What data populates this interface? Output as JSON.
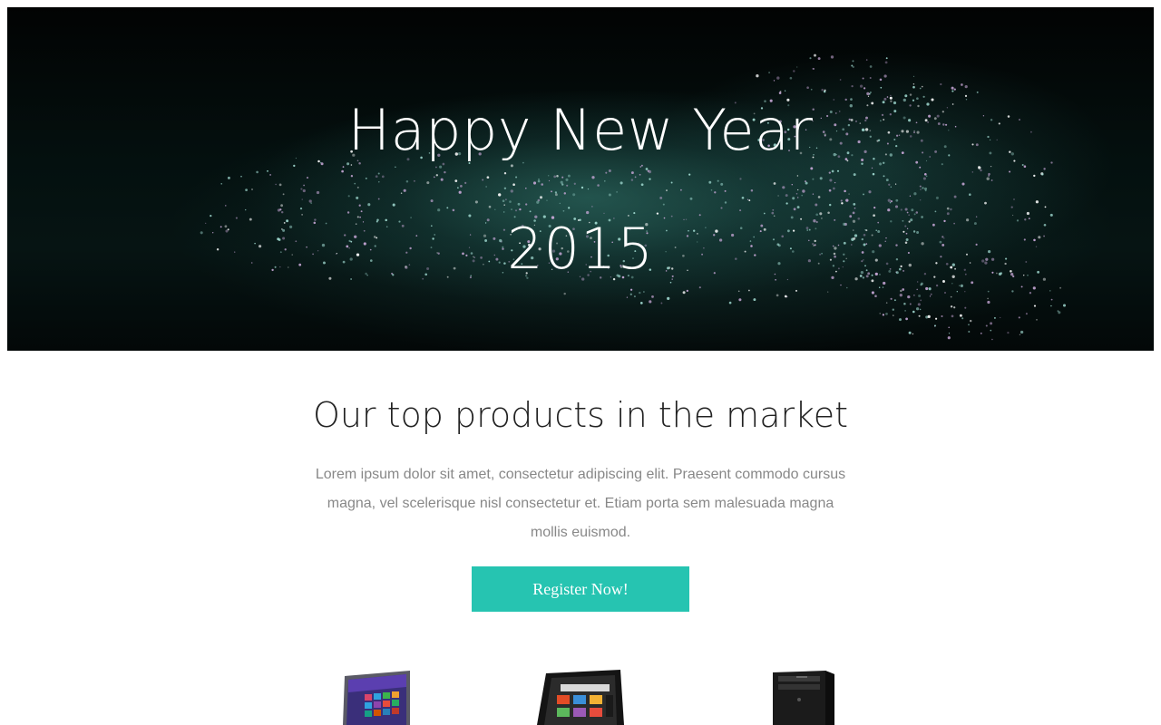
{
  "hero": {
    "title": "Happy New Year",
    "year": "2015"
  },
  "section": {
    "heading": "Our top products in the market",
    "text": "Lorem ipsum dolor sit amet, consectetur adipiscing elit. Praesent commodo cursus magna, vel scelerisque nisl consectetur et. Etiam porta sem malesuada magna mollis euismod.",
    "cta_label": "Register Now!"
  },
  "products": [
    {
      "icon": "laptop-icon"
    },
    {
      "icon": "tablet-icon"
    },
    {
      "icon": "desktop-tower-icon"
    }
  ],
  "colors": {
    "accent": "#26c4b1",
    "hero_bg": "#020303",
    "heading": "#222222",
    "body_text": "#888888"
  }
}
